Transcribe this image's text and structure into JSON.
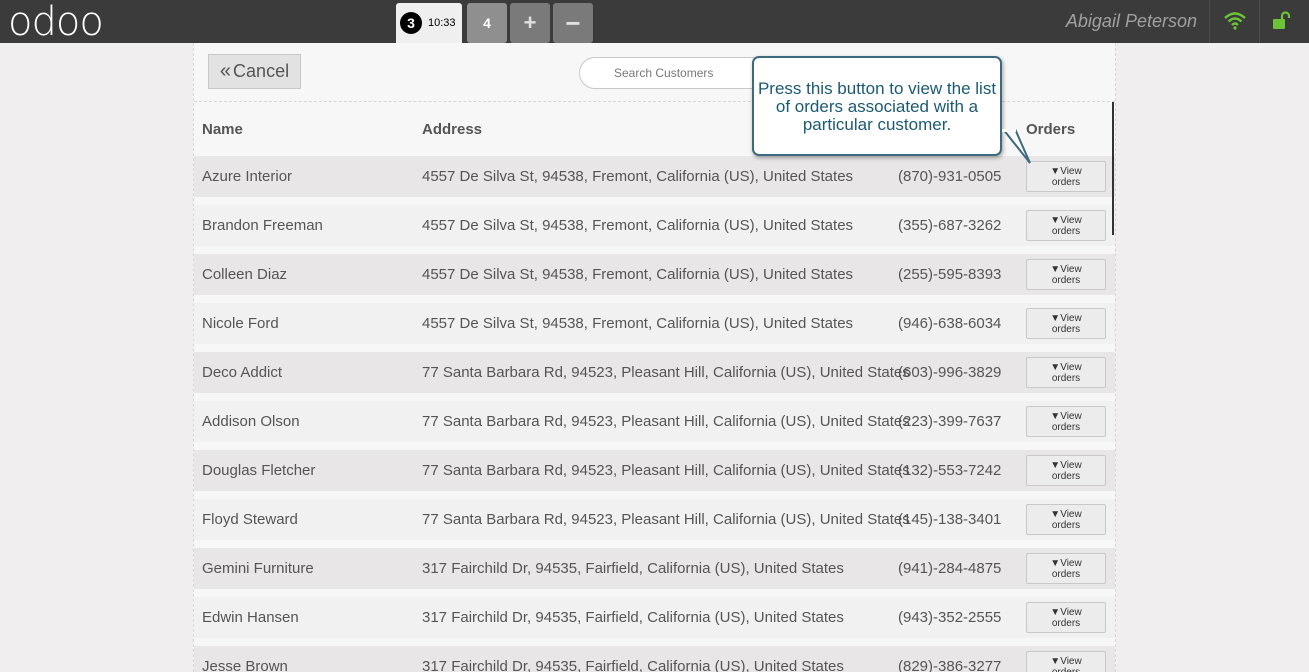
{
  "topbar": {
    "logo": "odoo",
    "order_number": "3",
    "order_time": "10:33",
    "tab_4": "4",
    "plus": "+",
    "minus": "−",
    "user": "Abigail Peterson",
    "colors": {
      "bar": "#3b3b3b",
      "status_green": "#6bc536"
    }
  },
  "header": {
    "cancel_label": "Cancel",
    "search_placeholder": "Search Customers"
  },
  "tooltip": {
    "text": "Press this button to view the list of orders associated with a particular customer."
  },
  "table": {
    "columns": [
      "Name",
      "Address",
      "Orders"
    ],
    "view_button": {
      "line1": "View",
      "line2": "orders"
    },
    "rows": [
      {
        "name": "Azure Interior",
        "address": "4557 De Silva St, 94538, Fremont, California (US), United States",
        "phone": "(870)-931-0505"
      },
      {
        "name": "Brandon Freeman",
        "address": "4557 De Silva St, 94538, Fremont, California (US), United States",
        "phone": "(355)-687-3262"
      },
      {
        "name": "Colleen Diaz",
        "address": "4557 De Silva St, 94538, Fremont, California (US), United States",
        "phone": "(255)-595-8393"
      },
      {
        "name": "Nicole Ford",
        "address": "4557 De Silva St, 94538, Fremont, California (US), United States",
        "phone": "(946)-638-6034"
      },
      {
        "name": "Deco Addict",
        "address": "77 Santa Barbara Rd, 94523, Pleasant Hill, California (US), United States",
        "phone": "(603)-996-3829"
      },
      {
        "name": "Addison Olson",
        "address": "77 Santa Barbara Rd, 94523, Pleasant Hill, California (US), United States",
        "phone": "(223)-399-7637"
      },
      {
        "name": "Douglas Fletcher",
        "address": "77 Santa Barbara Rd, 94523, Pleasant Hill, California (US), United States",
        "phone": "(132)-553-7242"
      },
      {
        "name": "Floyd Steward",
        "address": "77 Santa Barbara Rd, 94523, Pleasant Hill, California (US), United States",
        "phone": "(145)-138-3401"
      },
      {
        "name": "Gemini Furniture",
        "address": "317 Fairchild Dr, 94535, Fairfield, California (US), United States",
        "phone": "(941)-284-4875"
      },
      {
        "name": "Edwin Hansen",
        "address": "317 Fairchild Dr, 94535, Fairfield, California (US), United States",
        "phone": "(943)-352-2555"
      },
      {
        "name": "Jesse Brown",
        "address": "317 Fairchild Dr, 94535, Fairfield, California (US), United States",
        "phone": "(829)-386-3277"
      }
    ]
  }
}
